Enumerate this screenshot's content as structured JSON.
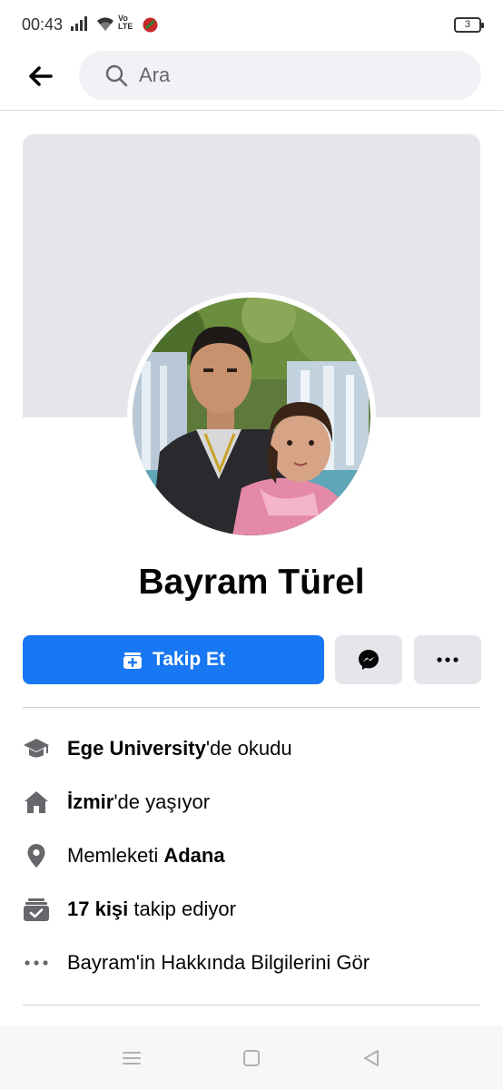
{
  "status_bar": {
    "time": "00:43",
    "volte_top": "Vo",
    "volte_bottom": "LTE",
    "battery": "3"
  },
  "header": {
    "back_icon": "arrow-left-icon",
    "search_placeholder": "Ara"
  },
  "profile": {
    "name": "Bayram Türel",
    "follow_label": "Takip Et",
    "cover_color": "#e4e6eb",
    "accent_color": "#1877f2"
  },
  "info": {
    "education": {
      "bold": "Ege University",
      "rest": "'de okudu",
      "icon": "graduation-cap-icon"
    },
    "lives": {
      "bold": "İzmir",
      "rest": "'de yaşıyor",
      "icon": "home-icon"
    },
    "hometown": {
      "prefix": "Memleketi ",
      "bold": "Adana",
      "icon": "location-pin-icon"
    },
    "followers": {
      "bold": "17 kişi",
      "rest": " takip ediyor",
      "icon": "followers-icon"
    },
    "about": {
      "text": "Bayram'in Hakkında Bilgilerini Gör",
      "icon": "more-horizontal-icon"
    }
  }
}
